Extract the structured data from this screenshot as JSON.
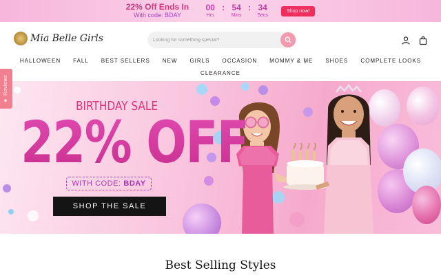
{
  "promo": {
    "title": "22% Off Ends In",
    "code": "With code: BDAY",
    "timer": {
      "hours": "00",
      "minutes": "54",
      "seconds": "34",
      "hours_label": "Hrs",
      "minutes_label": "Mins",
      "seconds_label": "Secs"
    },
    "button": "Shop now!"
  },
  "header": {
    "logo_text": "Mia Belle Girls",
    "search_placeholder": "Looking for something special?",
    "icons": [
      "search-icon",
      "account-icon",
      "cart-icon"
    ]
  },
  "nav": {
    "items": [
      "HALLOWEEN",
      "FALL",
      "BEST SELLERS",
      "NEW",
      "GIRLS",
      "OCCASION",
      "MOMMY & ME",
      "SHOES",
      "COMPLETE LOOKS"
    ],
    "items_row2": [
      "CLEARANCE"
    ]
  },
  "reviews_tab": {
    "label": "Reviews"
  },
  "hero": {
    "kicker": "BIRTHDAY SALE",
    "headline": "22% OFF",
    "code_prefix": "WITH CODE:",
    "code": "BDAY",
    "cta": "SHOP THE SALE"
  },
  "section": {
    "title": "Best Selling Styles"
  },
  "colors": {
    "accent": "#ee2f5e",
    "brand_pink": "#e040a0",
    "cta_dark": "#141414"
  }
}
